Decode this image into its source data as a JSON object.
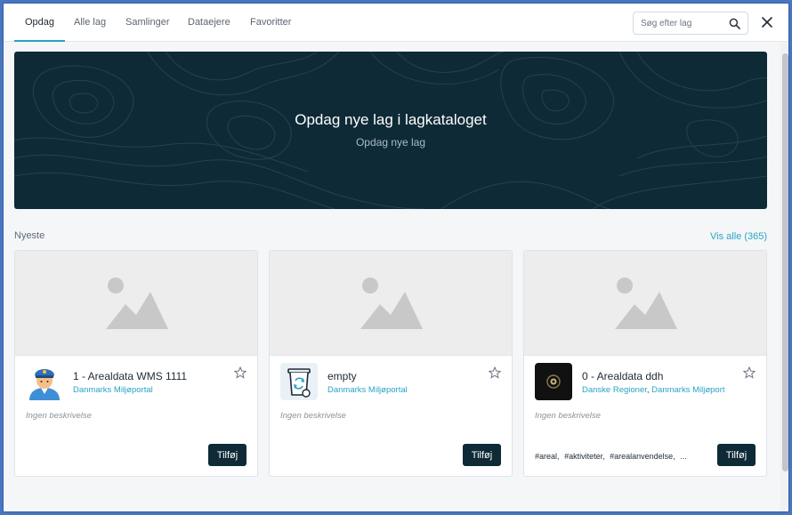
{
  "tabs": [
    {
      "label": "Opdag",
      "active": true
    },
    {
      "label": "Alle lag",
      "active": false
    },
    {
      "label": "Samlinger",
      "active": false
    },
    {
      "label": "Dataejere",
      "active": false
    },
    {
      "label": "Favoritter",
      "active": false
    }
  ],
  "search": {
    "placeholder": "Søg efter lag"
  },
  "hero": {
    "title": "Opdag nye lag i lagkataloget",
    "subtitle": "Opdag nye lag"
  },
  "section": {
    "title": "Nyeste",
    "view_all_label": "Vis alle",
    "view_all_count": "(365)"
  },
  "cards": [
    {
      "name": "1 - Arealdata WMS 1111",
      "owners": [
        "Danmarks Miljøportal"
      ],
      "description": "Ingen beskrivelse",
      "tags": [],
      "button": "Tilføj",
      "avatar_icon": "police-officer-icon"
    },
    {
      "name": "empty",
      "owners": [
        "Danmarks Miljøportal"
      ],
      "description": "Ingen beskrivelse",
      "tags": [],
      "button": "Tilføj",
      "avatar_icon": "recycle-bin-icon"
    },
    {
      "name": "0 - Arealdata ddh",
      "owners": [
        "Danske Regioner",
        "Danmarks Miljøport"
      ],
      "description": "Ingen beskrivelse",
      "tags": [
        "#areal",
        "#aktiviteter",
        "#arealanvendelse",
        "..."
      ],
      "button": "Tilføj",
      "avatar_icon": "dark-logo-icon"
    }
  ],
  "colors": {
    "accent": "#2aa3c3",
    "hero_bg": "#0e2a36",
    "button_bg": "#0e2a36"
  }
}
